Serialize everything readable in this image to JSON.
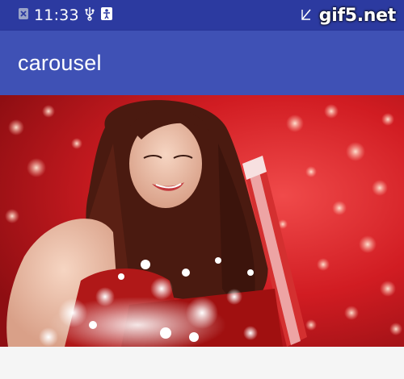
{
  "status_bar": {
    "time": "11:33",
    "icons": [
      "close-box-icon",
      "usb-icon",
      "accessibility-icon",
      "no-signal-icon",
      "battery-icon"
    ],
    "background": "#2c3aa0"
  },
  "watermark": {
    "text": "gif5.net"
  },
  "app_bar": {
    "title": "carousel",
    "background": "#3f51b5"
  },
  "carousel": {
    "image_subject": "woman-opening-gift-box-with-sparkles",
    "background": "#c4141a"
  }
}
